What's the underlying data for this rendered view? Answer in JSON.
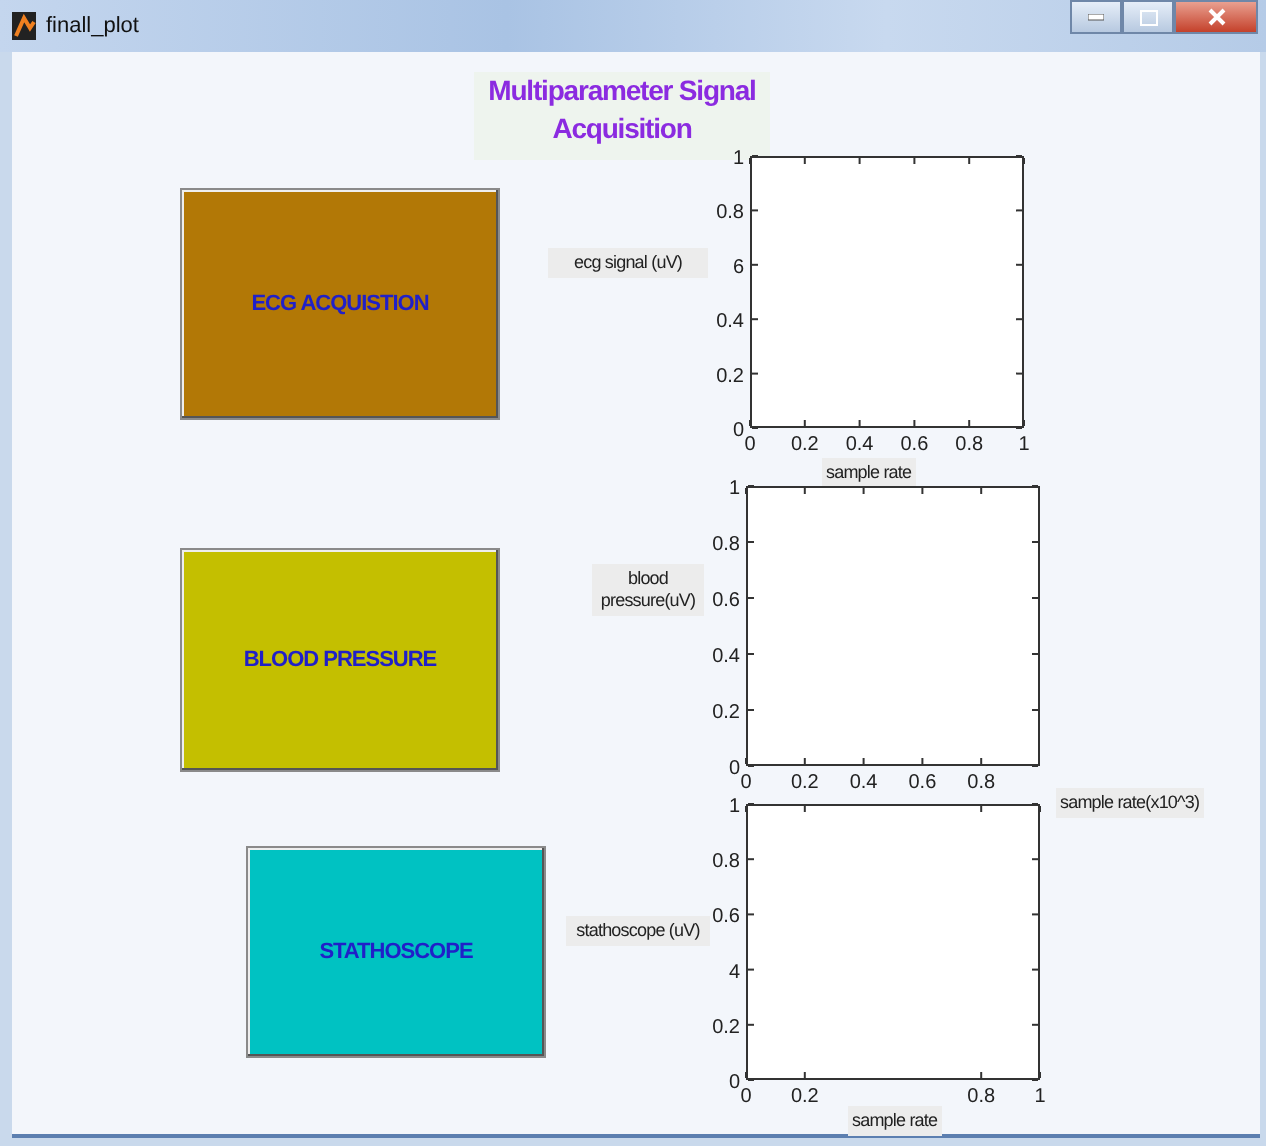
{
  "window": {
    "title": "finall_plot"
  },
  "title_panel": {
    "lines": [
      "Multiparameter Signal",
      "Acquisition"
    ]
  },
  "buttons": [
    {
      "label": "ECG ACQUISTION",
      "color": "#b27806"
    },
    {
      "label": "BLOOD PRESSURE",
      "color": "#c4bf00"
    },
    {
      "label": "STATHOSCOPE",
      "color": "#00c2c2"
    }
  ],
  "axes": [
    {
      "ylabel": "ecg signal (uV)",
      "xlabel": "sample rate",
      "x_ticks": [
        "0",
        "0.2",
        "0.4",
        "0.6",
        "0.8",
        "1"
      ],
      "y_ticks": [
        "1",
        "0.8",
        "6",
        "0.4",
        "0.2",
        "0"
      ]
    },
    {
      "ylabel": "blood pressure(uV)",
      "xlabel": "sample rate(x10^3)",
      "x_ticks": [
        "0",
        "0.2",
        "0.4",
        "0.6",
        "0.8"
      ],
      "y_ticks": [
        "1",
        "0.8",
        "0.6",
        "0.4",
        "0.2",
        "0"
      ]
    },
    {
      "ylabel": "stathoscope (uV)",
      "xlabel": "sample rate",
      "x_ticks": [
        "0",
        "0.2",
        "0.8",
        "1"
      ],
      "y_ticks": [
        "1",
        "0.8",
        "0.6",
        "4",
        "0.2",
        "0"
      ]
    }
  ]
}
